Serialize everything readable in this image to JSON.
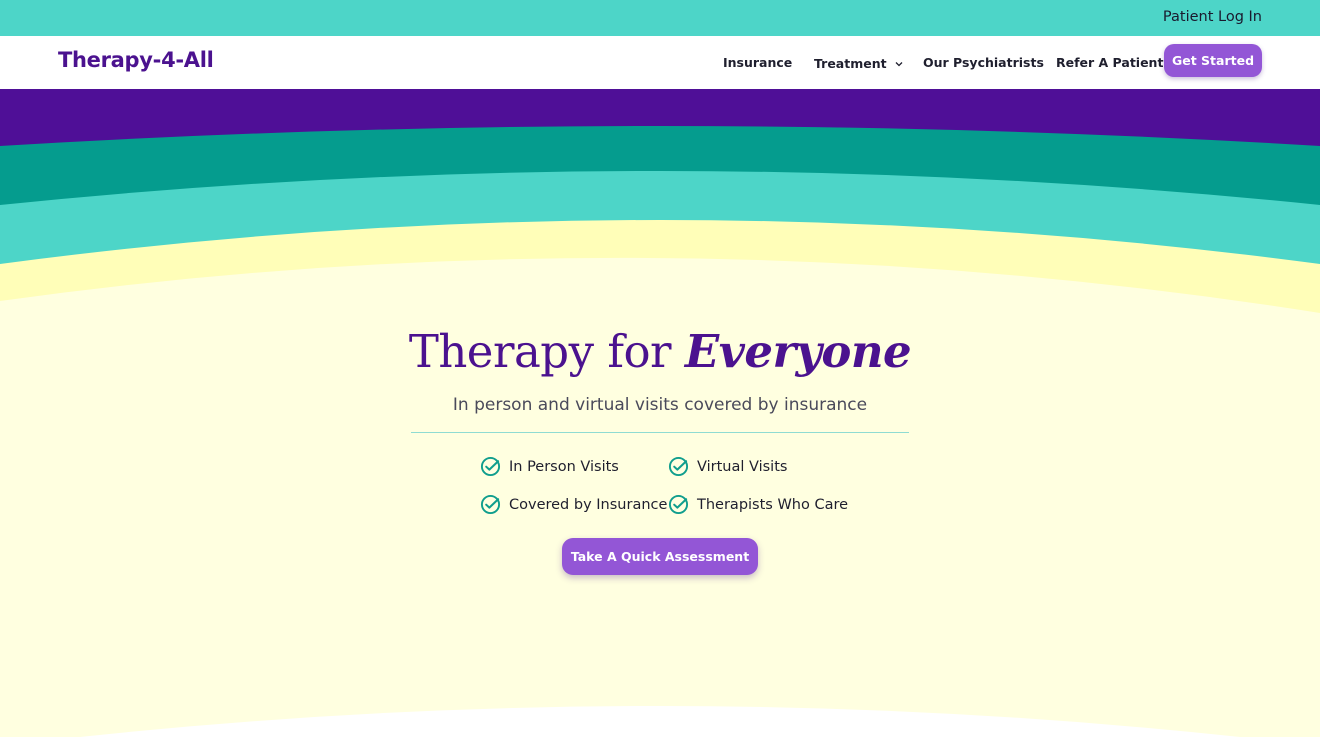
{
  "topbar": {
    "login_label": "Patient Log In"
  },
  "brand": {
    "name": "Therapy-4-All"
  },
  "nav": {
    "items": [
      {
        "label": "Insurance"
      },
      {
        "label": "Treatment"
      },
      {
        "label": "Our Psychiatrists"
      },
      {
        "label": "Refer A Patient"
      }
    ],
    "cta_label": "Get Started",
    "treatment_icon": "chevron-down-icon"
  },
  "hero": {
    "title_plain": "Therapy for ",
    "title_emphasis": "Everyone",
    "subtitle": "In person and virtual visits covered by insurance",
    "features": [
      {
        "label": "In Person Visits",
        "icon": "check-circle-icon"
      },
      {
        "label": "Virtual Visits",
        "icon": "check-circle-icon"
      },
      {
        "label": "Covered by Insurance",
        "icon": "check-circle-icon"
      },
      {
        "label": "Therapists Who Care",
        "icon": "check-circle-icon"
      }
    ],
    "cta_label": "Take A Quick Assessment"
  },
  "colors": {
    "topbar": "#4dd5c8",
    "brand_purple": "#4b128f",
    "deep_purple_band": "#4f0f97",
    "teal_band": "#059c8e",
    "aqua_band": "#4dd5c8",
    "yellow_band": "#fffeb8",
    "hero_background": "#ffffe0",
    "button_purple": "#9356d6",
    "check_color": "#109e8d"
  }
}
